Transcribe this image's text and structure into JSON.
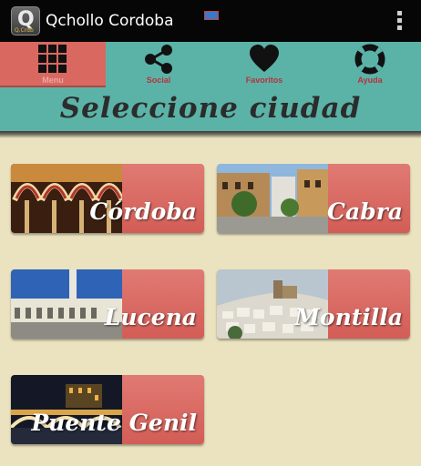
{
  "app": {
    "title": "Qchollo Cordoba",
    "icon_letter": "Q",
    "icon_caption": "Q.Crdb"
  },
  "tabs": [
    {
      "label": "Menu",
      "icon": "grid-icon",
      "selected": true
    },
    {
      "label": "Social",
      "icon": "share-icon",
      "selected": false
    },
    {
      "label": "Favoritos",
      "icon": "heart-icon",
      "selected": false
    },
    {
      "label": "Ayuda",
      "icon": "lifebuoy-icon",
      "selected": false
    }
  ],
  "header": {
    "title": "Seleccione ciudad"
  },
  "cities": [
    {
      "name": "Córdoba",
      "photo": "mezquita-arches"
    },
    {
      "name": "Cabra",
      "photo": "town-square"
    },
    {
      "name": "Lucena",
      "photo": "bullring"
    },
    {
      "name": "Montilla",
      "photo": "hill-town"
    },
    {
      "name": "Puente Genil",
      "photo": "night-bridge"
    }
  ],
  "colors": {
    "actionbar": "#060606",
    "teal": "#5bb3a8",
    "tab_selected": "#d96861",
    "card_red": "#d96861",
    "background": "#ebe2bf",
    "tab_label": "#b8323c"
  }
}
